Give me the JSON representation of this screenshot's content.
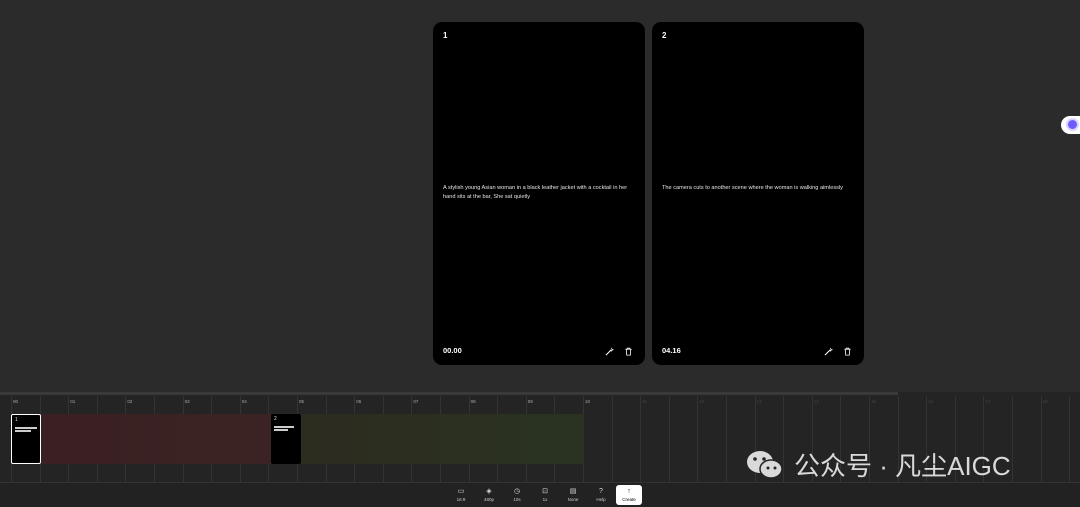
{
  "cards": [
    {
      "number": "1",
      "description": "A stylish young Asian woman in a black leather jacket with a cocktail in her hand sits at the bar, She sat quietly",
      "time": "00.00"
    },
    {
      "number": "2",
      "description": "The camera cuts to another scene where the woman is walking aimlessly",
      "time": "04.16"
    }
  ],
  "ruler": [
    "00",
    "01",
    "02",
    "03",
    "04",
    "05",
    "06",
    "07",
    "08",
    "09",
    "10",
    "11",
    "12",
    "13",
    "14",
    "15",
    "16",
    "17",
    "18"
  ],
  "clips": [
    {
      "number": "1"
    },
    {
      "number": "2"
    }
  ],
  "toolbar": {
    "aspect_label": "16:9",
    "resolution_label": "480p",
    "duration_label": "10s",
    "count_label": "1x",
    "style_label": "None",
    "help_label": "Help",
    "create_label": "Create"
  },
  "watermark": {
    "text": "公众号 · 凡尘AIGC"
  },
  "icons": {
    "edit": "wand-edit-icon",
    "delete": "trash-icon",
    "side": "assistant-orb-icon"
  }
}
